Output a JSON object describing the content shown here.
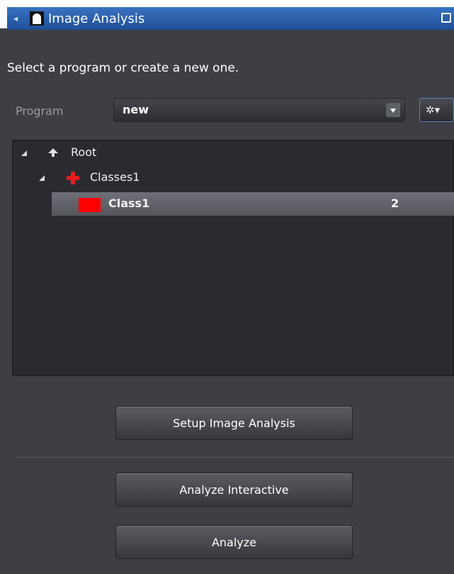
{
  "window": {
    "title": "Image Analysis"
  },
  "instruction": "Select a program or create a new one.",
  "program": {
    "label": "Program",
    "selected": "new",
    "gear_label": "✲▾"
  },
  "tree": {
    "root": {
      "label": "Root"
    },
    "classes": {
      "label": "Classes1"
    },
    "class1": {
      "label": "Class1",
      "count": "2",
      "color": "#ff0000"
    }
  },
  "buttons": {
    "setup": "Setup Image Analysis",
    "analyze_interactive": "Analyze Interactive",
    "analyze": "Analyze"
  },
  "colors": {
    "title_bar": "#2a5fad",
    "panel_bg": "#3e3f44",
    "tree_bg": "#2a2b30",
    "class_icon": "#e21e1e"
  }
}
